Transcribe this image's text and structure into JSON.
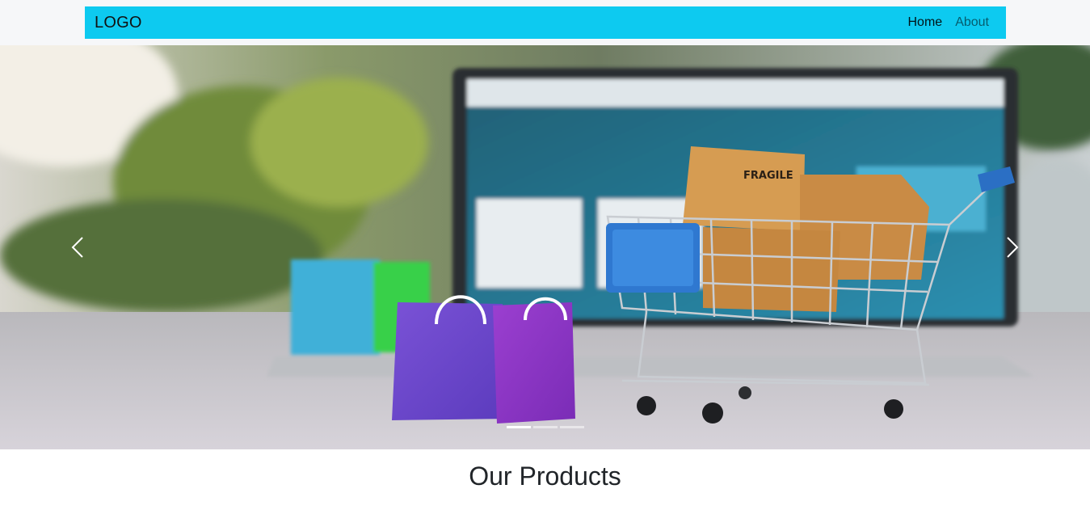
{
  "navbar": {
    "logo": "LOGO",
    "links": [
      {
        "label": "Home",
        "active": true
      },
      {
        "label": "About",
        "active": false
      }
    ],
    "background_color": "#0dcaf0"
  },
  "carousel": {
    "slide_image": "online-shopping-cart-with-boxes-and-bags-in-front-of-laptop",
    "box_label": "FRAGILE",
    "prev_icon": "chevron-left-icon",
    "next_icon": "chevron-right-icon",
    "indicator_count": 3,
    "active_indicator": 0
  },
  "products_section": {
    "title": "Our Products"
  }
}
